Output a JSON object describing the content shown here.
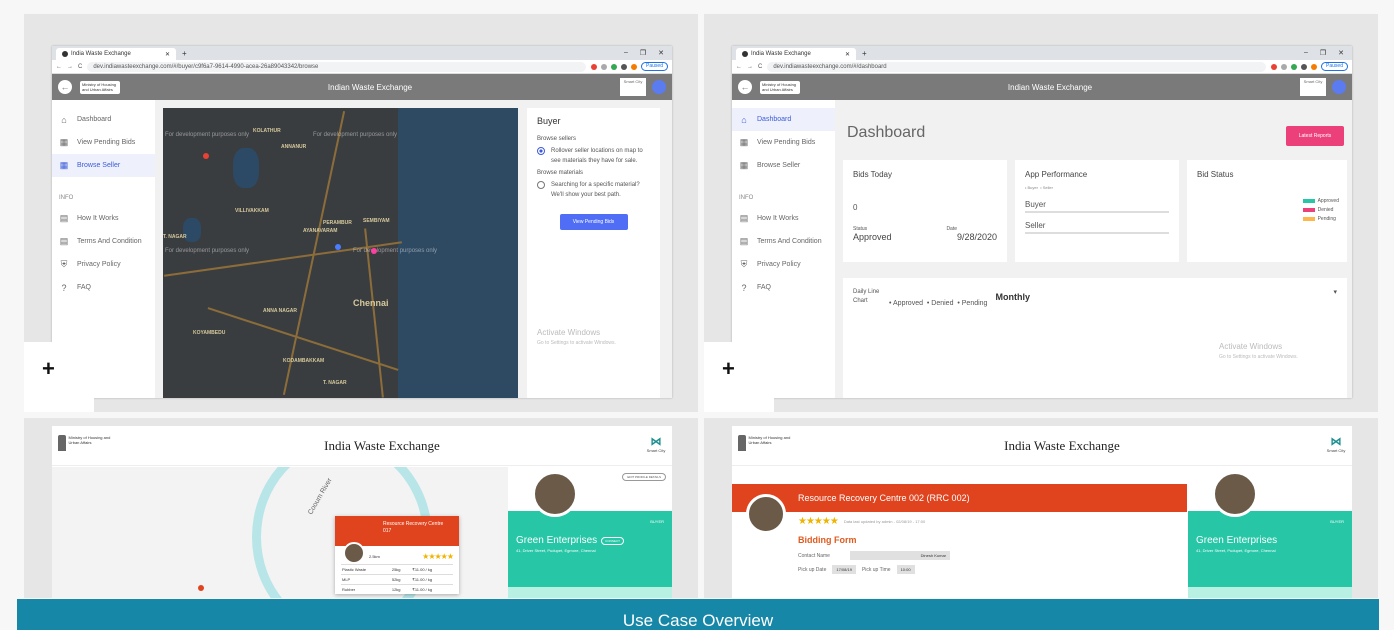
{
  "browser": {
    "tab_title": "India Waste Exchange",
    "win_controls": [
      "–",
      "❐",
      "✕"
    ],
    "paused_label": "Paused",
    "nav_glyphs": [
      "←",
      "→",
      "C"
    ]
  },
  "map_screen": {
    "url": "dev.indiawasteexchange.com/#/buyer/c9f6a7-9614-4990-acea-26a89043342/browse",
    "app_title": "Indian Waste Exchange",
    "ministry": "Ministry of Housing and Urban Affairs",
    "smartcity": "Smart City",
    "sidebar": [
      {
        "label": "Dashboard",
        "icon": "⌂"
      },
      {
        "label": "View Pending Bids",
        "icon": "▦"
      },
      {
        "label": "Browse Seller",
        "icon": "▦"
      }
    ],
    "info_label": "INFO",
    "info_items": [
      {
        "label": "How It Works",
        "icon": "▤"
      },
      {
        "label": "Terms And Condition",
        "icon": "▤"
      },
      {
        "label": "Privacy Policy",
        "icon": "⛨"
      },
      {
        "label": "FAQ",
        "icon": "?"
      }
    ],
    "watermark": "For development purposes only",
    "map_labels": [
      "AYANAVARAM",
      "PERAMBUR",
      "ANNA NAGAR",
      "KOYAMBEDU",
      "Chennai",
      "KODAMBAKKAM",
      "T. NAGAR",
      "KOLATHUR",
      "VILLIVAKKAM",
      "ANNANUR",
      "SEMBIYAM"
    ],
    "buyer": {
      "title": "Buyer",
      "browse_sellers": "Browse sellers",
      "opt1": "Rollover seller locations on map to see materials they have for sale.",
      "browse_materials": "Browse materials",
      "opt2": "Searching for a specific material? We'll show your best path.",
      "button": "View Pending Bids"
    },
    "activate": "Activate Windows",
    "activate_sub": "Go to Settings to activate Windows."
  },
  "dashboard_screen": {
    "url": "dev.indiawasteexchange.com/#/dashboard",
    "app_title": "Indian Waste Exchange",
    "title": "Dashboard",
    "latest_reports": "Latest Reports",
    "bids_today": {
      "title": "Bids Today",
      "count": "0",
      "status_label": "Status",
      "status": "Approved",
      "date_label": "Date",
      "date": "9/28/2020"
    },
    "app_performance": {
      "title": "App Performance",
      "legend": [
        "Buyer",
        "Seller"
      ],
      "rows": [
        "Buyer",
        "Seller"
      ]
    },
    "bid_status": {
      "title": "Bid Status",
      "legend": [
        "Approved",
        "Denied",
        "Pending"
      ],
      "colors": [
        "#26c6a6",
        "#ec407a",
        "#ffb74d"
      ]
    },
    "daily": {
      "label": "Daily Line Chart",
      "legend": [
        "Approved",
        "Denied",
        "Pending"
      ],
      "period": "Monthly",
      "chevron": "▾"
    },
    "activate": "Activate Windows",
    "activate_sub": "Go to Settings to activate Windows."
  },
  "street_screen": {
    "title": "India Waste Exchange",
    "ministry": "Ministry of Housing and Urban Affairs",
    "smartcity": "Smart City",
    "popup_title": "Resource Recovery Centre 017",
    "distance": "2.5km",
    "rows": [
      [
        "Plastic Waste",
        "25kg",
        "₹11.00 / kg"
      ],
      [
        "MLP",
        "52kg",
        "₹11.00 / kg"
      ],
      [
        "Rubber",
        "12kg",
        "₹11.00 / kg"
      ]
    ],
    "road_label": "Cooum River",
    "profile": {
      "button": "EDIT PROFILE DETAILS",
      "tag": "BUYER",
      "name": "Green Enterprises",
      "connect": "CONNECT",
      "address": "41, Driver Street, Pudupet, Egmore, Chennai"
    }
  },
  "bidding_screen": {
    "title": "India Waste Exchange",
    "ministry": "Ministry of Housing and Urban Affairs",
    "smartcity": "Smart City",
    "rrc": "Resource Recovery Centre 002 (RRC 002)",
    "updated": "Data last updated by admin - 02/08/19 - 17:00",
    "form_title": "Bidding Form",
    "contact_label": "Contact Name",
    "contact_value": "Dinesh Kumar",
    "pickup_date_label": "Pick up Date",
    "pickup_date": "17/08/19",
    "pickup_time_label": "Pick up Time",
    "pickup_time": "10:00",
    "profile": {
      "tag": "BUYER",
      "name": "Green Enterprises",
      "address": "41, Driver Street, Pudupet, Egmore, Chennai"
    }
  },
  "plus_label": "+",
  "stars": "★★★★★",
  "caption": "Use Case Overview"
}
